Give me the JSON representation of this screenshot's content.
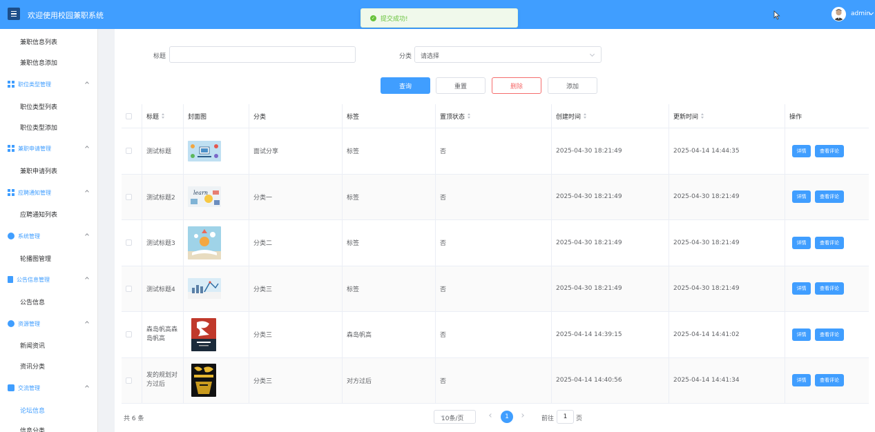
{
  "header": {
    "title": "欢迎使用校园兼职系统",
    "user": "admin"
  },
  "toast": {
    "text": "提交成功!"
  },
  "sidebar": {
    "items": [
      {
        "type": "sub",
        "label": "兼职信息列表"
      },
      {
        "type": "sub",
        "label": "兼职信息添加"
      },
      {
        "type": "group",
        "label": "职位类型管理",
        "icon": "grid-icon"
      },
      {
        "type": "sub",
        "label": "职位类型列表"
      },
      {
        "type": "sub",
        "label": "职位类型添加"
      },
      {
        "type": "group",
        "label": "兼职申请管理",
        "icon": "grid-icon"
      },
      {
        "type": "sub",
        "label": "兼职申请列表"
      },
      {
        "type": "group",
        "label": "应聘通知管理",
        "icon": "grid-icon"
      },
      {
        "type": "sub",
        "label": "应聘通知列表"
      },
      {
        "type": "group",
        "label": "系统管理",
        "icon": "gear-icon"
      },
      {
        "type": "sub",
        "label": "轮播图管理"
      },
      {
        "type": "group",
        "label": "公告信息管理",
        "icon": "document-icon"
      },
      {
        "type": "sub",
        "label": "公告信息"
      },
      {
        "type": "group",
        "label": "资源管理",
        "icon": "plus-circle-icon"
      },
      {
        "type": "sub",
        "label": "新闻资讯"
      },
      {
        "type": "sub",
        "label": "资讯分类"
      },
      {
        "type": "group",
        "label": "交流管理",
        "icon": "chat-icon"
      },
      {
        "type": "sub",
        "label": "论坛信息",
        "active": true
      },
      {
        "type": "sub",
        "label": "信息分类"
      }
    ]
  },
  "search": {
    "title_label": "标题",
    "title_value": "",
    "category_label": "分类",
    "category_placeholder": "请选择",
    "query_btn": "查询",
    "reset_btn": "重置",
    "delete_btn": "删除",
    "add_btn": "添加"
  },
  "table": {
    "headers": {
      "title": "标题",
      "cover": "封面图",
      "category": "分类",
      "tag": "标签",
      "top_status": "置顶状态",
      "created": "创建时间",
      "updated": "更新时间",
      "actions": "操作"
    },
    "rows": [
      {
        "title": "测试标题",
        "category": "面试分享",
        "tag": "标签",
        "top": "否",
        "created": "2025-04-30 18:21:49",
        "updated": "2025-04-14 14:44:35"
      },
      {
        "title": "测试标题2",
        "category": "分类一",
        "tag": "标签",
        "top": "否",
        "created": "2025-04-30 18:21:49",
        "updated": "2025-04-30 18:21:49"
      },
      {
        "title": "测试标题3",
        "category": "分类二",
        "tag": "标签",
        "top": "否",
        "created": "2025-04-30 18:21:49",
        "updated": "2025-04-30 18:21:49"
      },
      {
        "title": "测试标题4",
        "category": "分类三",
        "tag": "标签",
        "top": "否",
        "created": "2025-04-30 18:21:49",
        "updated": "2025-04-30 18:21:49"
      },
      {
        "title": "森岛帆高森岛帆高",
        "category": "分类三",
        "tag": "森岛帆高",
        "top": "否",
        "created": "2025-04-14 14:39:15",
        "updated": "2025-04-14 14:41:02"
      },
      {
        "title": "发的规划对方过后",
        "category": "分类三",
        "tag": "对方过后",
        "top": "否",
        "created": "2025-04-14 14:40:56",
        "updated": "2025-04-14 14:41:34"
      }
    ],
    "detail_btn": "详情",
    "comments_btn": "查看评论"
  },
  "pagination": {
    "total": "共 6 条",
    "page_size": "10条/页",
    "current": "1",
    "goto_label": "前往",
    "goto_value": "1",
    "page_suffix": "页"
  },
  "colors": {
    "primary": "#409eff",
    "danger": "#f56c6c",
    "success": "#67c23a"
  }
}
